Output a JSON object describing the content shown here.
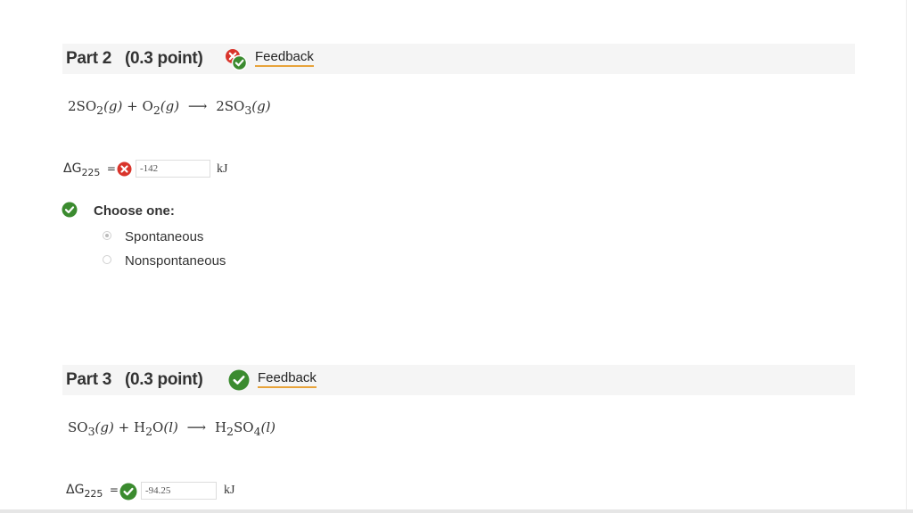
{
  "parts": [
    {
      "title": "Part 2",
      "points": "(0.3 point)",
      "feedback_label": "Feedback",
      "reaction": {
        "lhs1_coef": "2SO",
        "lhs1_sub": "2",
        "lhs1_state": "(g)",
        "plus": "+",
        "lhs2": "O",
        "lhs2_sub": "2",
        "lhs2_state": "(g)",
        "arrow": "⟶",
        "rhs1_coef": "2SO",
        "rhs1_sub": "3",
        "rhs1_state": "(g)"
      },
      "dg_symbol": "ΔG",
      "dg_sub": "225",
      "dg_eq": "=",
      "answer_value": "-142",
      "unit": "kJ",
      "choose_label": "Choose one:",
      "options": [
        "Spontaneous",
        "Nonspontaneous"
      ],
      "selected_option": "Spontaneous"
    },
    {
      "title": "Part 3",
      "points": "(0.3 point)",
      "feedback_label": "Feedback",
      "reaction": {
        "r1": "SO",
        "r1_sub": "3",
        "r1_state": "(g)",
        "plus": "+",
        "r2": "H",
        "r2_sub": "2",
        "r2_tail": "O",
        "r2_state": "(l)",
        "arrow": "⟶",
        "p1": "H",
        "p1_sub": "2",
        "p1_mid": "SO",
        "p1_sub2": "4",
        "p1_state": "(l)"
      },
      "dg_symbol": "ΔG",
      "dg_sub": "225",
      "dg_eq": "=",
      "answer_value": "-94.25",
      "unit": "kJ"
    }
  ],
  "colors": {
    "error_red": "#d9342b",
    "correct_green": "#3b8b2f",
    "feedback_underline": "#e8a33a",
    "header_bg": "#f5f5f5"
  }
}
